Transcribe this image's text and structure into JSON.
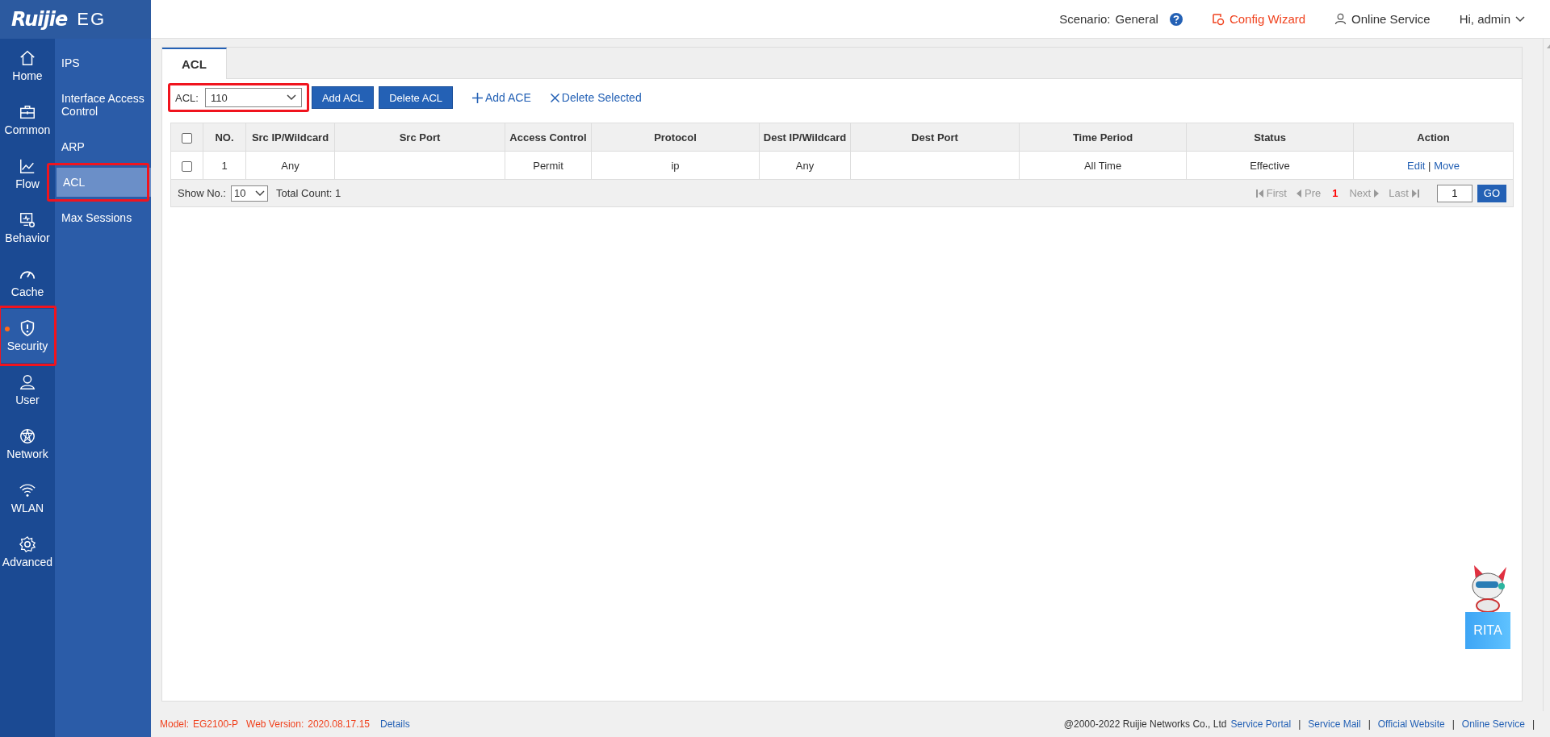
{
  "brand": {
    "logo": "Ruijie",
    "product": "EG"
  },
  "header": {
    "scenario_label": "Scenario:",
    "scenario_value": "General",
    "config_wizard": "Config Wizard",
    "online_service": "Online Service",
    "user_menu": "Hi, admin"
  },
  "nav": [
    {
      "label": "Home",
      "kind": "home",
      "selected": false,
      "highlighted": false
    },
    {
      "label": "Common",
      "kind": "toolbox",
      "selected": false,
      "highlighted": false
    },
    {
      "label": "Flow",
      "kind": "chart",
      "selected": false,
      "highlighted": false
    },
    {
      "label": "Behavior",
      "kind": "monitor",
      "selected": false,
      "highlighted": false
    },
    {
      "label": "Cache",
      "kind": "gauge",
      "selected": false,
      "highlighted": false
    },
    {
      "label": "Security",
      "kind": "shield",
      "selected": true,
      "highlighted": true
    },
    {
      "label": "User",
      "kind": "user",
      "selected": false,
      "highlighted": false
    },
    {
      "label": "Network",
      "kind": "globe",
      "selected": false,
      "highlighted": false
    },
    {
      "label": "WLAN",
      "kind": "wifi",
      "selected": false,
      "highlighted": false
    },
    {
      "label": "Advanced",
      "kind": "gear",
      "selected": false,
      "highlighted": false
    }
  ],
  "submenu": [
    {
      "label": "IPS",
      "selected": false,
      "highlighted": false
    },
    {
      "label": "Interface Access Control",
      "selected": false,
      "highlighted": false
    },
    {
      "label": "ARP",
      "selected": false,
      "highlighted": false
    },
    {
      "label": "ACL",
      "selected": true,
      "highlighted": true
    },
    {
      "label": "Max Sessions",
      "selected": false,
      "highlighted": false
    }
  ],
  "tabs": [
    {
      "label": "ACL",
      "selected": true
    }
  ],
  "toolbar": {
    "acl_label": "ACL:",
    "acl_value": "110",
    "highlighted": true,
    "buttons": [
      "Add ACL",
      "Delete ACL"
    ],
    "links": [
      {
        "label": "Add ACE",
        "kind": "add"
      },
      {
        "label": "Delete Selected",
        "kind": "delete"
      }
    ]
  },
  "table": {
    "all_checked": false,
    "columns": [
      "NO.",
      "Src IP/Wildcard",
      "Src Port",
      "Access Control",
      "Protocol",
      "Dest IP/Wildcard",
      "Dest Port",
      "Time Period",
      "Status",
      "Action"
    ],
    "rows": [
      {
        "checked": false,
        "cells": [
          "1",
          "Any",
          null,
          "Permit",
          "ip",
          "Any",
          null,
          "All Time",
          "Effective"
        ],
        "actions": [
          "Edit",
          "Move"
        ],
        "action_separator": "|"
      }
    ]
  },
  "pager": {
    "show_no_label": "Show No.:",
    "page_size": "10",
    "total": "Total Count: 1",
    "first": "First",
    "pre": "Pre",
    "current": "1",
    "next": "Next",
    "last": "Last",
    "page_input": "1",
    "go": "GO"
  },
  "assistant": {
    "label": "RITA"
  },
  "footer": {
    "model_label": "Model:",
    "model": "EG2100-P",
    "version_label": "Web Version:",
    "version": "2020.08.17.15",
    "details": "Details",
    "copyright": "@2000-2022 Ruijie Networks Co., Ltd",
    "links": [
      "Service Portal",
      "Service Mail",
      "Official Website",
      "Online Service"
    ],
    "link_separator": "|"
  }
}
